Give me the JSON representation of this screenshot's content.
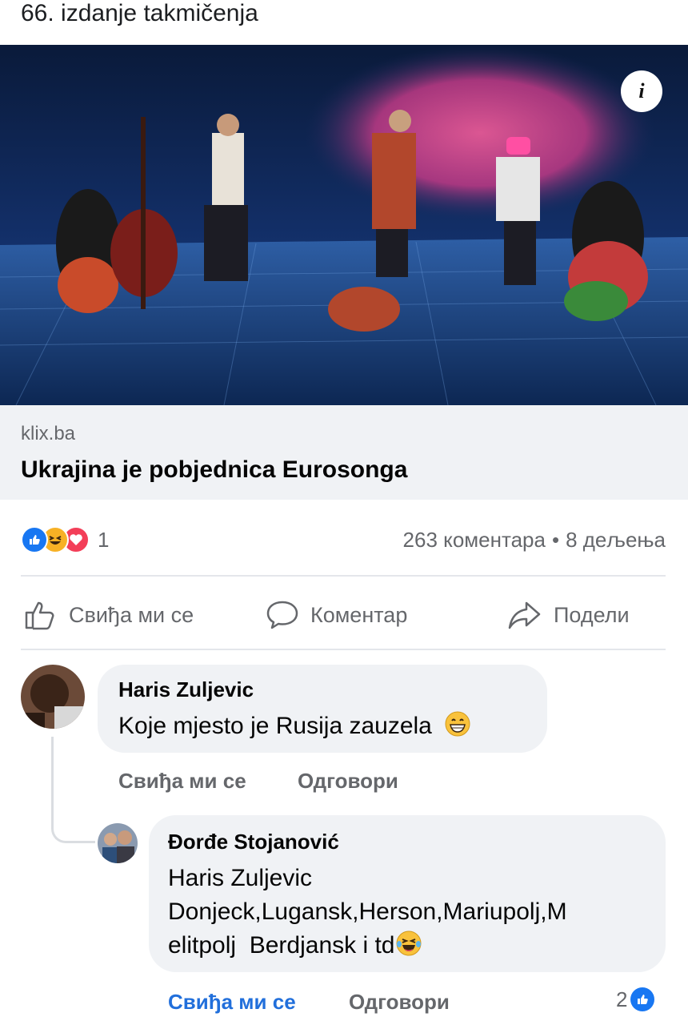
{
  "post": {
    "text": "66. izdanje takmičenja"
  },
  "link": {
    "domain": "klix.ba",
    "title": "Ukrajina je pobjednica Eurosonga"
  },
  "reactions": {
    "count": "1",
    "types": [
      "like-icon",
      "haha-icon",
      "love-icon"
    ]
  },
  "stats": {
    "comments": "263 коментара",
    "separator": "•",
    "shares": "8 дељења"
  },
  "actions": {
    "like": "Свиђа ми се",
    "comment": "Коментар",
    "share": "Подели"
  },
  "comments": [
    {
      "author": "Haris Zuljevic",
      "text": "Koje mjesto je Rusija zauzela",
      "emoji": "grinning-face-icon",
      "like_label": "Свиђа ми се",
      "reply_label": "Одговори"
    },
    {
      "author": "Đorđe Stojanović",
      "text_line1": "Haris Zuljevic",
      "text_line2": "Donjeck,Lugansk,Herson,Mariupolj,M",
      "text_line3": "elitpolj  Berdjansk i td",
      "emoji": "laughing-tears-icon",
      "like_label": "Свиђа ми се",
      "reply_label": "Одговори",
      "reaction_count": "2"
    }
  ],
  "colors": {
    "facebook_blue": "#1877f2",
    "liked_blue": "#216fdb",
    "muted": "#65676b",
    "bubble": "#f0f2f5"
  }
}
